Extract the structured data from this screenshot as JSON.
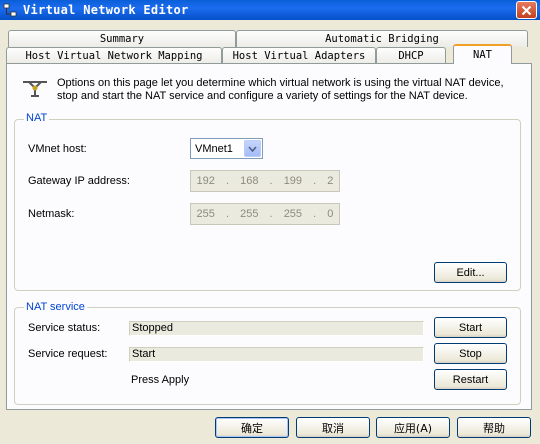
{
  "window": {
    "title": "Virtual Network Editor"
  },
  "tabs": {
    "row1": [
      {
        "label": "Summary"
      },
      {
        "label": "Automatic Bridging"
      }
    ],
    "row2": [
      {
        "label": "Host Virtual Network Mapping"
      },
      {
        "label": "Host Virtual Adapters"
      },
      {
        "label": "DHCP"
      },
      {
        "label": "NAT"
      }
    ]
  },
  "info": {
    "text": "Options on this page let you determine which virtual network is using the virtual NAT device, stop and start the NAT service and configure a variety of settings for the NAT device."
  },
  "nat": {
    "legend": "NAT",
    "vmnet_host_label": "VMnet host:",
    "vmnet_host_value": "VMnet1",
    "gateway_label": "Gateway IP address:",
    "gateway_octets": [
      "192",
      "168",
      "199",
      "2"
    ],
    "netmask_label": "Netmask:",
    "netmask_octets": [
      "255",
      "255",
      "255",
      "0"
    ],
    "edit_button": "Edit..."
  },
  "nat_service": {
    "legend": "NAT service",
    "status_label": "Service status:",
    "status_value": "Stopped",
    "request_label": "Service request:",
    "request_value": "Start",
    "note": "Press Apply",
    "start_button": "Start",
    "stop_button": "Stop",
    "restart_button": "Restart"
  },
  "footer": {
    "ok": "确定",
    "cancel": "取消",
    "apply": "应用(A)",
    "help": "帮助"
  },
  "colors": {
    "title_bar": "#0a5fd8",
    "group_legend": "#0046d5",
    "active_tab_accent": "#f0a027"
  },
  "icons": {
    "app": "network-app-icon",
    "close": "close-icon",
    "info": "network-connector-icon",
    "dropdown": "chevron-down-icon"
  }
}
